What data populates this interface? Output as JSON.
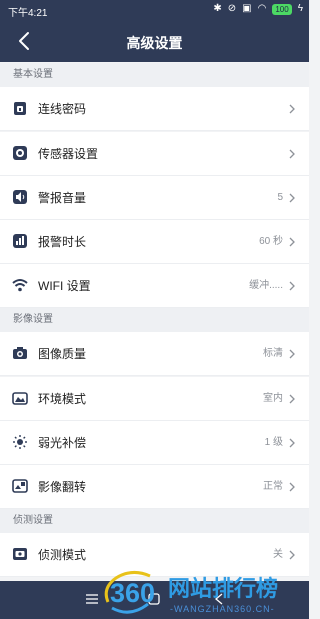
{
  "status": {
    "time": "下午4:21",
    "battery": "100"
  },
  "header": {
    "title": "高级设置"
  },
  "sections": [
    {
      "title": "基本设置"
    },
    {
      "title": "影像设置"
    },
    {
      "title": "侦测设置"
    }
  ],
  "rows": [
    {
      "label": "连线密码",
      "value": "",
      "icon": "lock-icon"
    },
    {
      "label": "传感器设置",
      "value": "",
      "icon": "sensor-icon"
    },
    {
      "label": "警报音量",
      "value": "5",
      "icon": "volume-icon"
    },
    {
      "label": "报警时长",
      "value": "60 秒",
      "icon": "alarm-duration-icon"
    },
    {
      "label": "WIFI 设置",
      "value": "缓冲.....",
      "icon": "wifi-icon"
    },
    {
      "label": "图像质量",
      "value": "标清",
      "icon": "camera-icon"
    },
    {
      "label": "环境模式",
      "value": "室内",
      "icon": "environment-icon"
    },
    {
      "label": "弱光补偿",
      "value": "1 级",
      "icon": "low-light-icon"
    },
    {
      "label": "影像翻转",
      "value": "正常",
      "icon": "flip-icon"
    },
    {
      "label": "侦测模式",
      "value": "关",
      "icon": "detection-icon"
    }
  ],
  "watermark": {
    "logo_text": "360",
    "brand": "网站排行榜",
    "url": "-WANGZHAN360.CN-"
  }
}
